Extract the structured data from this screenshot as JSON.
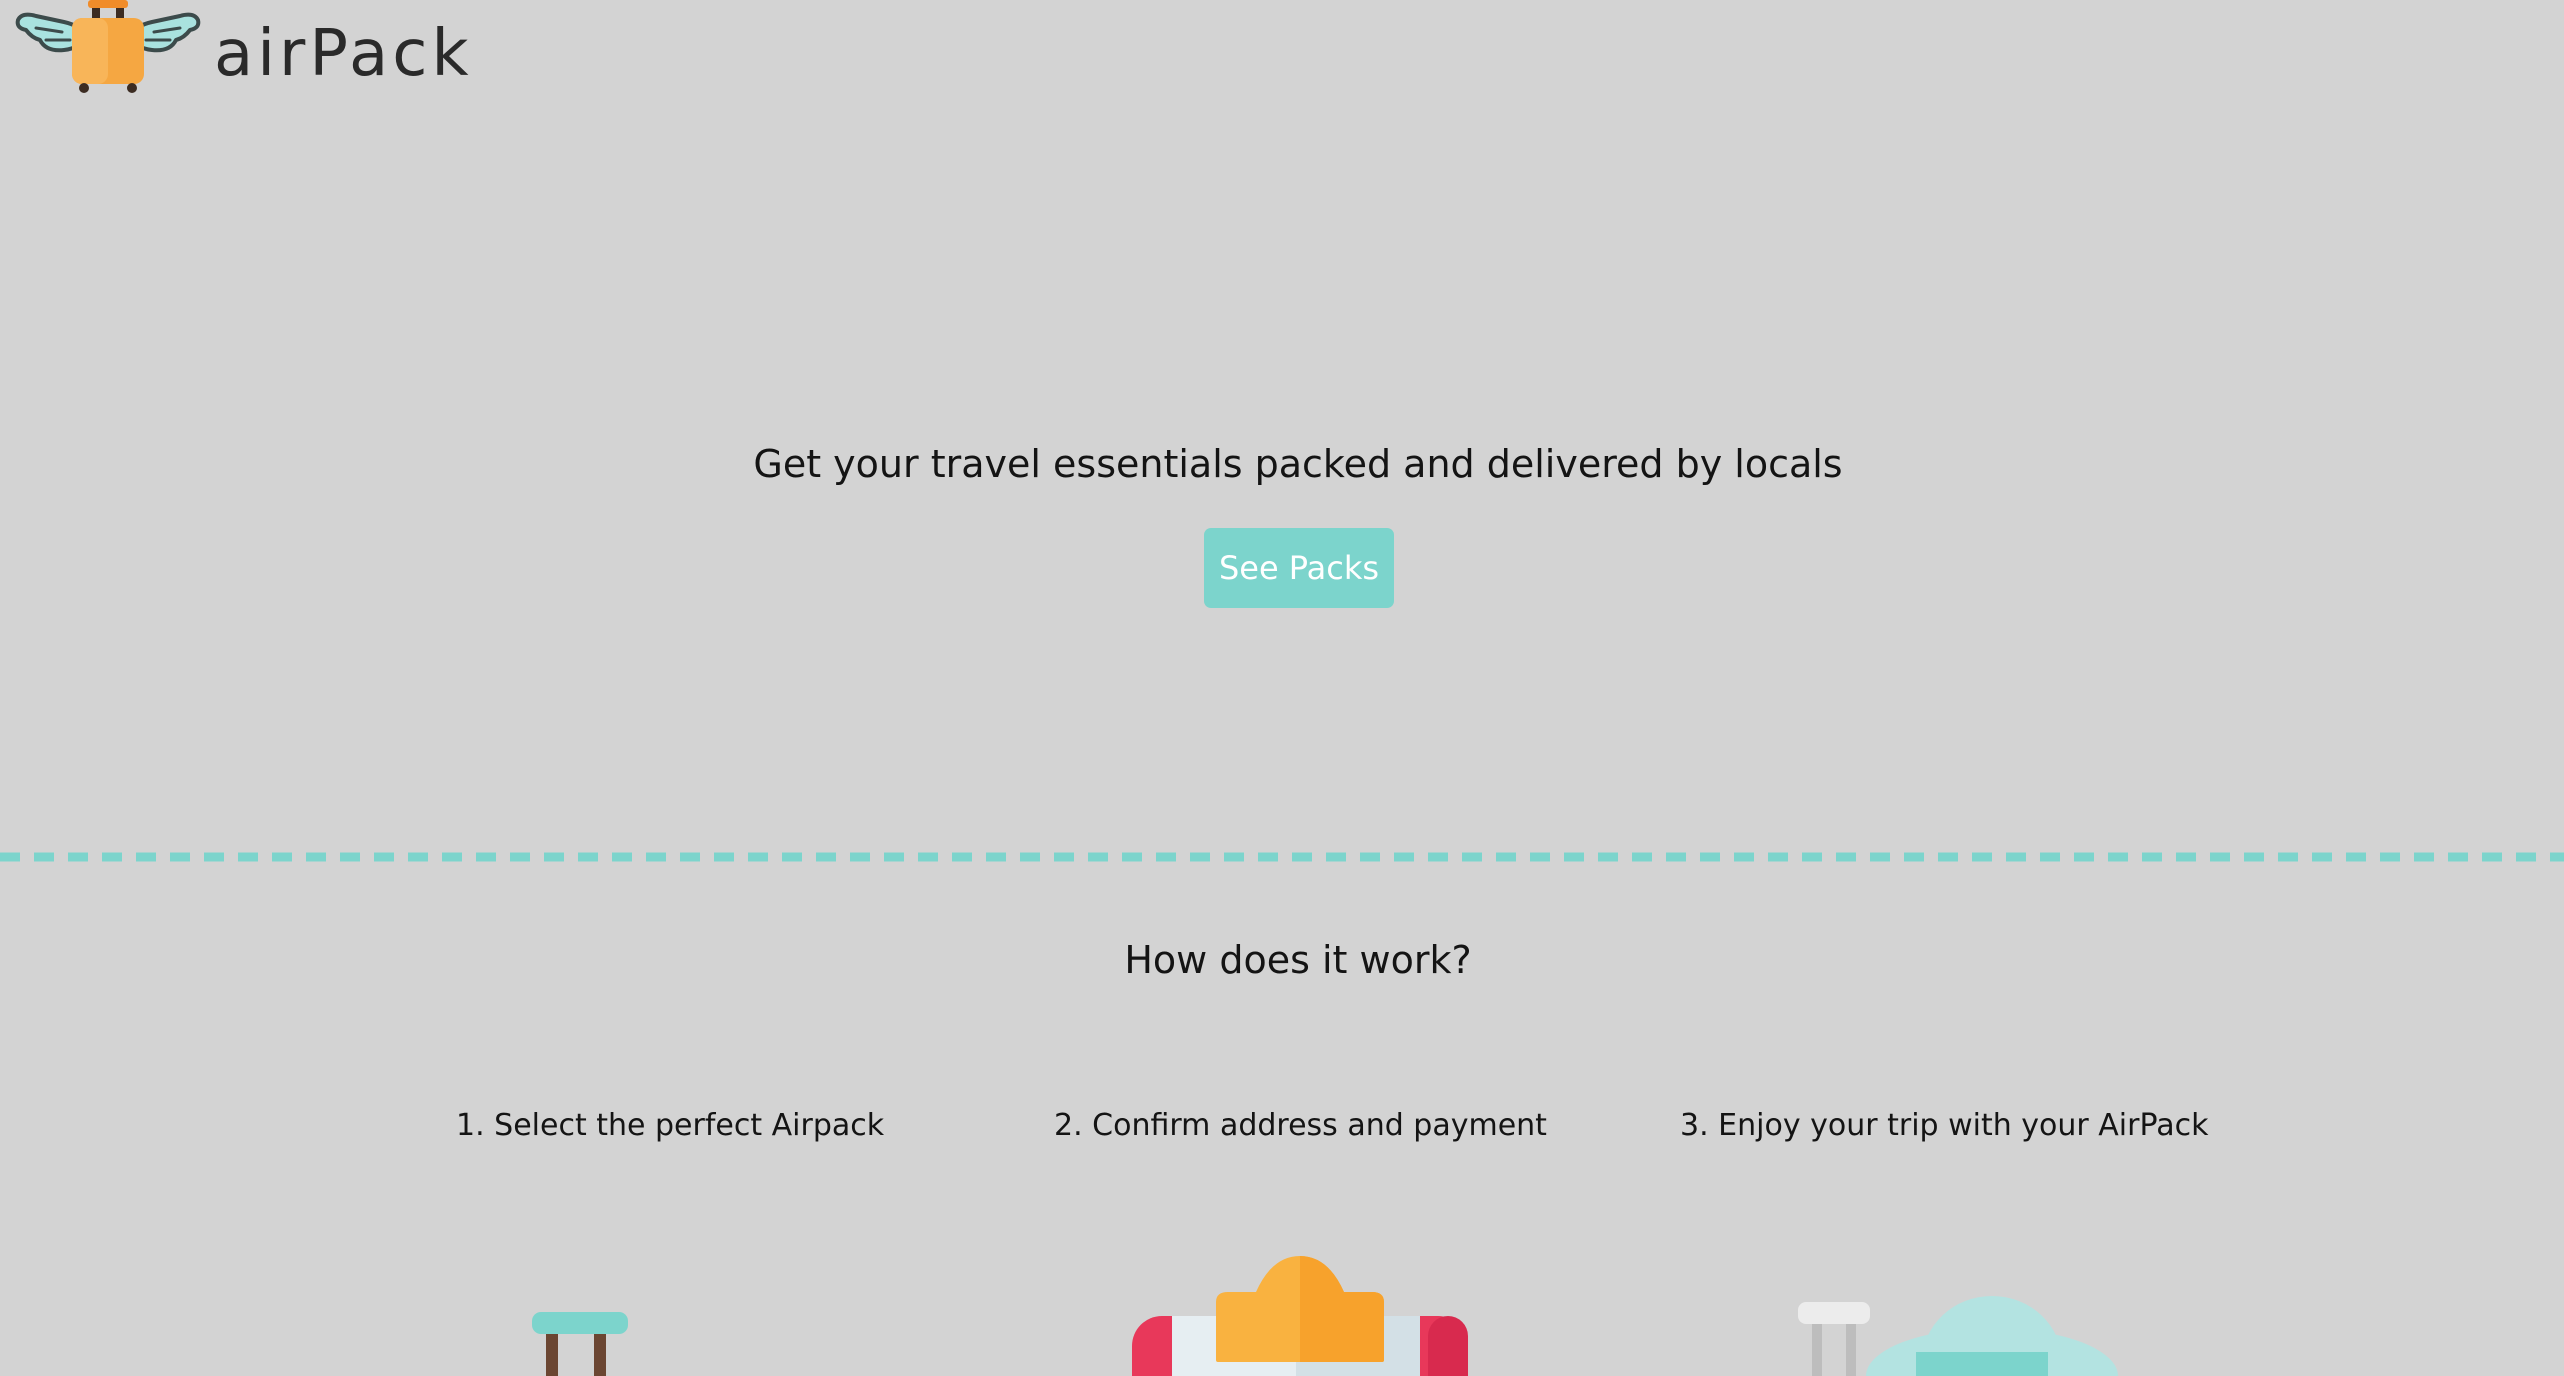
{
  "header": {
    "brand_name": "airPack",
    "logo_icon": "winged-suitcase-icon"
  },
  "hero": {
    "tagline": "Get your travel essentials packed and delivered by locals",
    "cta_label": "See Packs"
  },
  "how_it_works": {
    "title": "How does it work?",
    "steps": [
      {
        "label": "1. Select the perfect Airpack",
        "icon": "luggage-cart-icon"
      },
      {
        "label": "2. Confirm address and payment",
        "icon": "package-icon"
      },
      {
        "label": "3. Enjoy your trip with your AirPack",
        "icon": "travel-hat-icon"
      }
    ]
  },
  "colors": {
    "background": "#d3d3d3",
    "accent_teal": "#7cd4cc",
    "suitcase_orange": "#f5a742",
    "wing_teal": "#a9e2df",
    "package_red": "#e8385a",
    "text": "#141414"
  }
}
